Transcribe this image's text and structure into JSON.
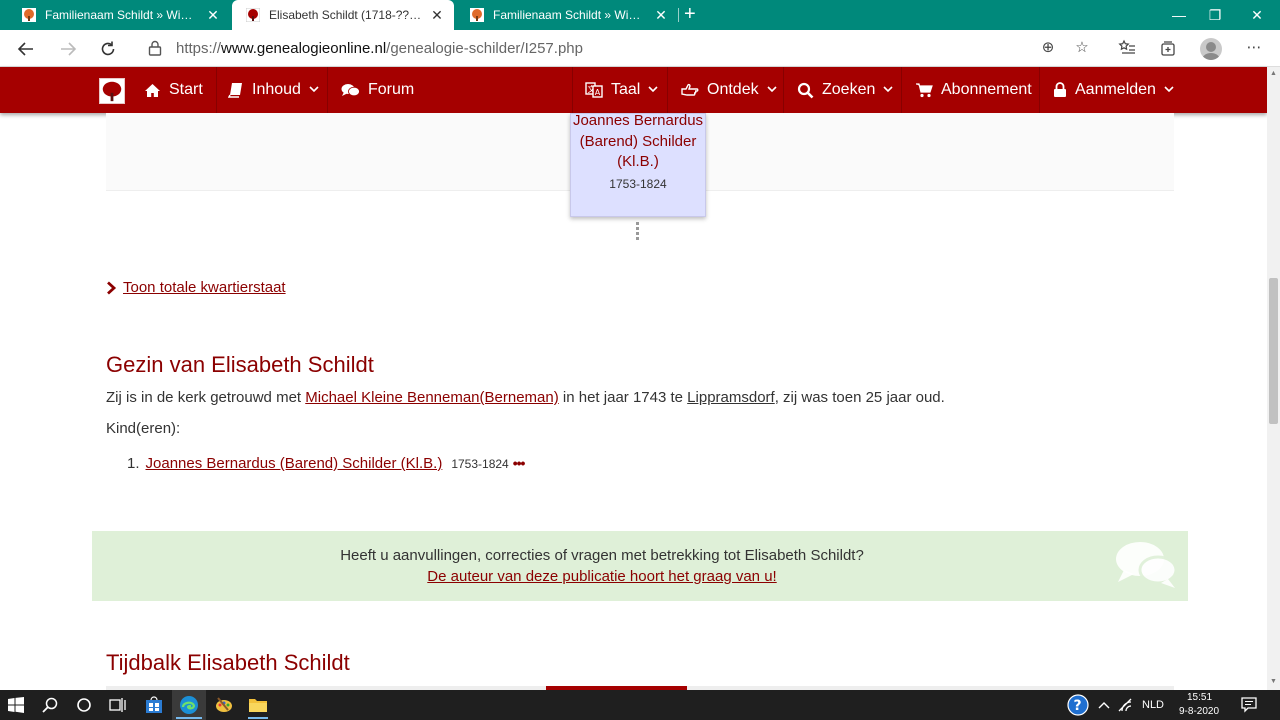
{
  "browser": {
    "tabs": [
      {
        "title": "Familienaam Schildt » Wie (onderzoekt)",
        "active": false
      },
      {
        "title": "Elisabeth Schildt (1718-????) » Genealogie",
        "active": true
      },
      {
        "title": "Familienaam Schildt » Wie (onderzoekt)",
        "active": false
      }
    ],
    "url_scheme": "https://",
    "url_host": "www.genealogieonline.nl",
    "url_path": "/genealogie-schilder/I257.php"
  },
  "nav": {
    "start": "Start",
    "inhoud": "Inhoud",
    "forum": "Forum",
    "taal": "Taal",
    "ontdek": "Ontdek",
    "zoeken": "Zoeken",
    "abonnement": "Abonnement",
    "aanmelden": "Aanmelden"
  },
  "pedigree": {
    "name": "Joannes Bernardus (Barend) Schilder (Kl.B.)",
    "years": "1753-1824"
  },
  "toon_link": "Toon totale kwartierstaat",
  "gezin": {
    "heading": "Gezin van Elisabeth Schildt",
    "text_1": "Zij is in de kerk getrouwd met ",
    "spouse": "Michael Kleine Benneman(Berneman)",
    "text_2": " in het jaar 1743 te ",
    "place": "Lippramsdorf",
    "text_3": ", zij was toen 25 jaar oud.",
    "children_label": "Kind(eren):",
    "children": [
      {
        "num": "1.",
        "name": "Joannes Bernardus (Barend) Schilder (Kl.B.)",
        "years": "1753-1824",
        "more": "•••"
      }
    ]
  },
  "feedback": {
    "question": "Heeft u aanvullingen, correcties of vragen met betrekking tot Elisabeth Schildt?",
    "link": "De auteur van deze publicatie hoort het graag van u!"
  },
  "tijdbalk": {
    "heading": "Tijdbalk Elisabeth Schildt"
  },
  "taskbar": {
    "language": "NLD",
    "time": "15:51",
    "date": "9-8-2020"
  },
  "colors": {
    "brand": "#a50000",
    "tabstrip": "#00897b",
    "link": "#8b0000",
    "feedback_bg": "#dff0d8",
    "person_box": "#dde0ff"
  }
}
